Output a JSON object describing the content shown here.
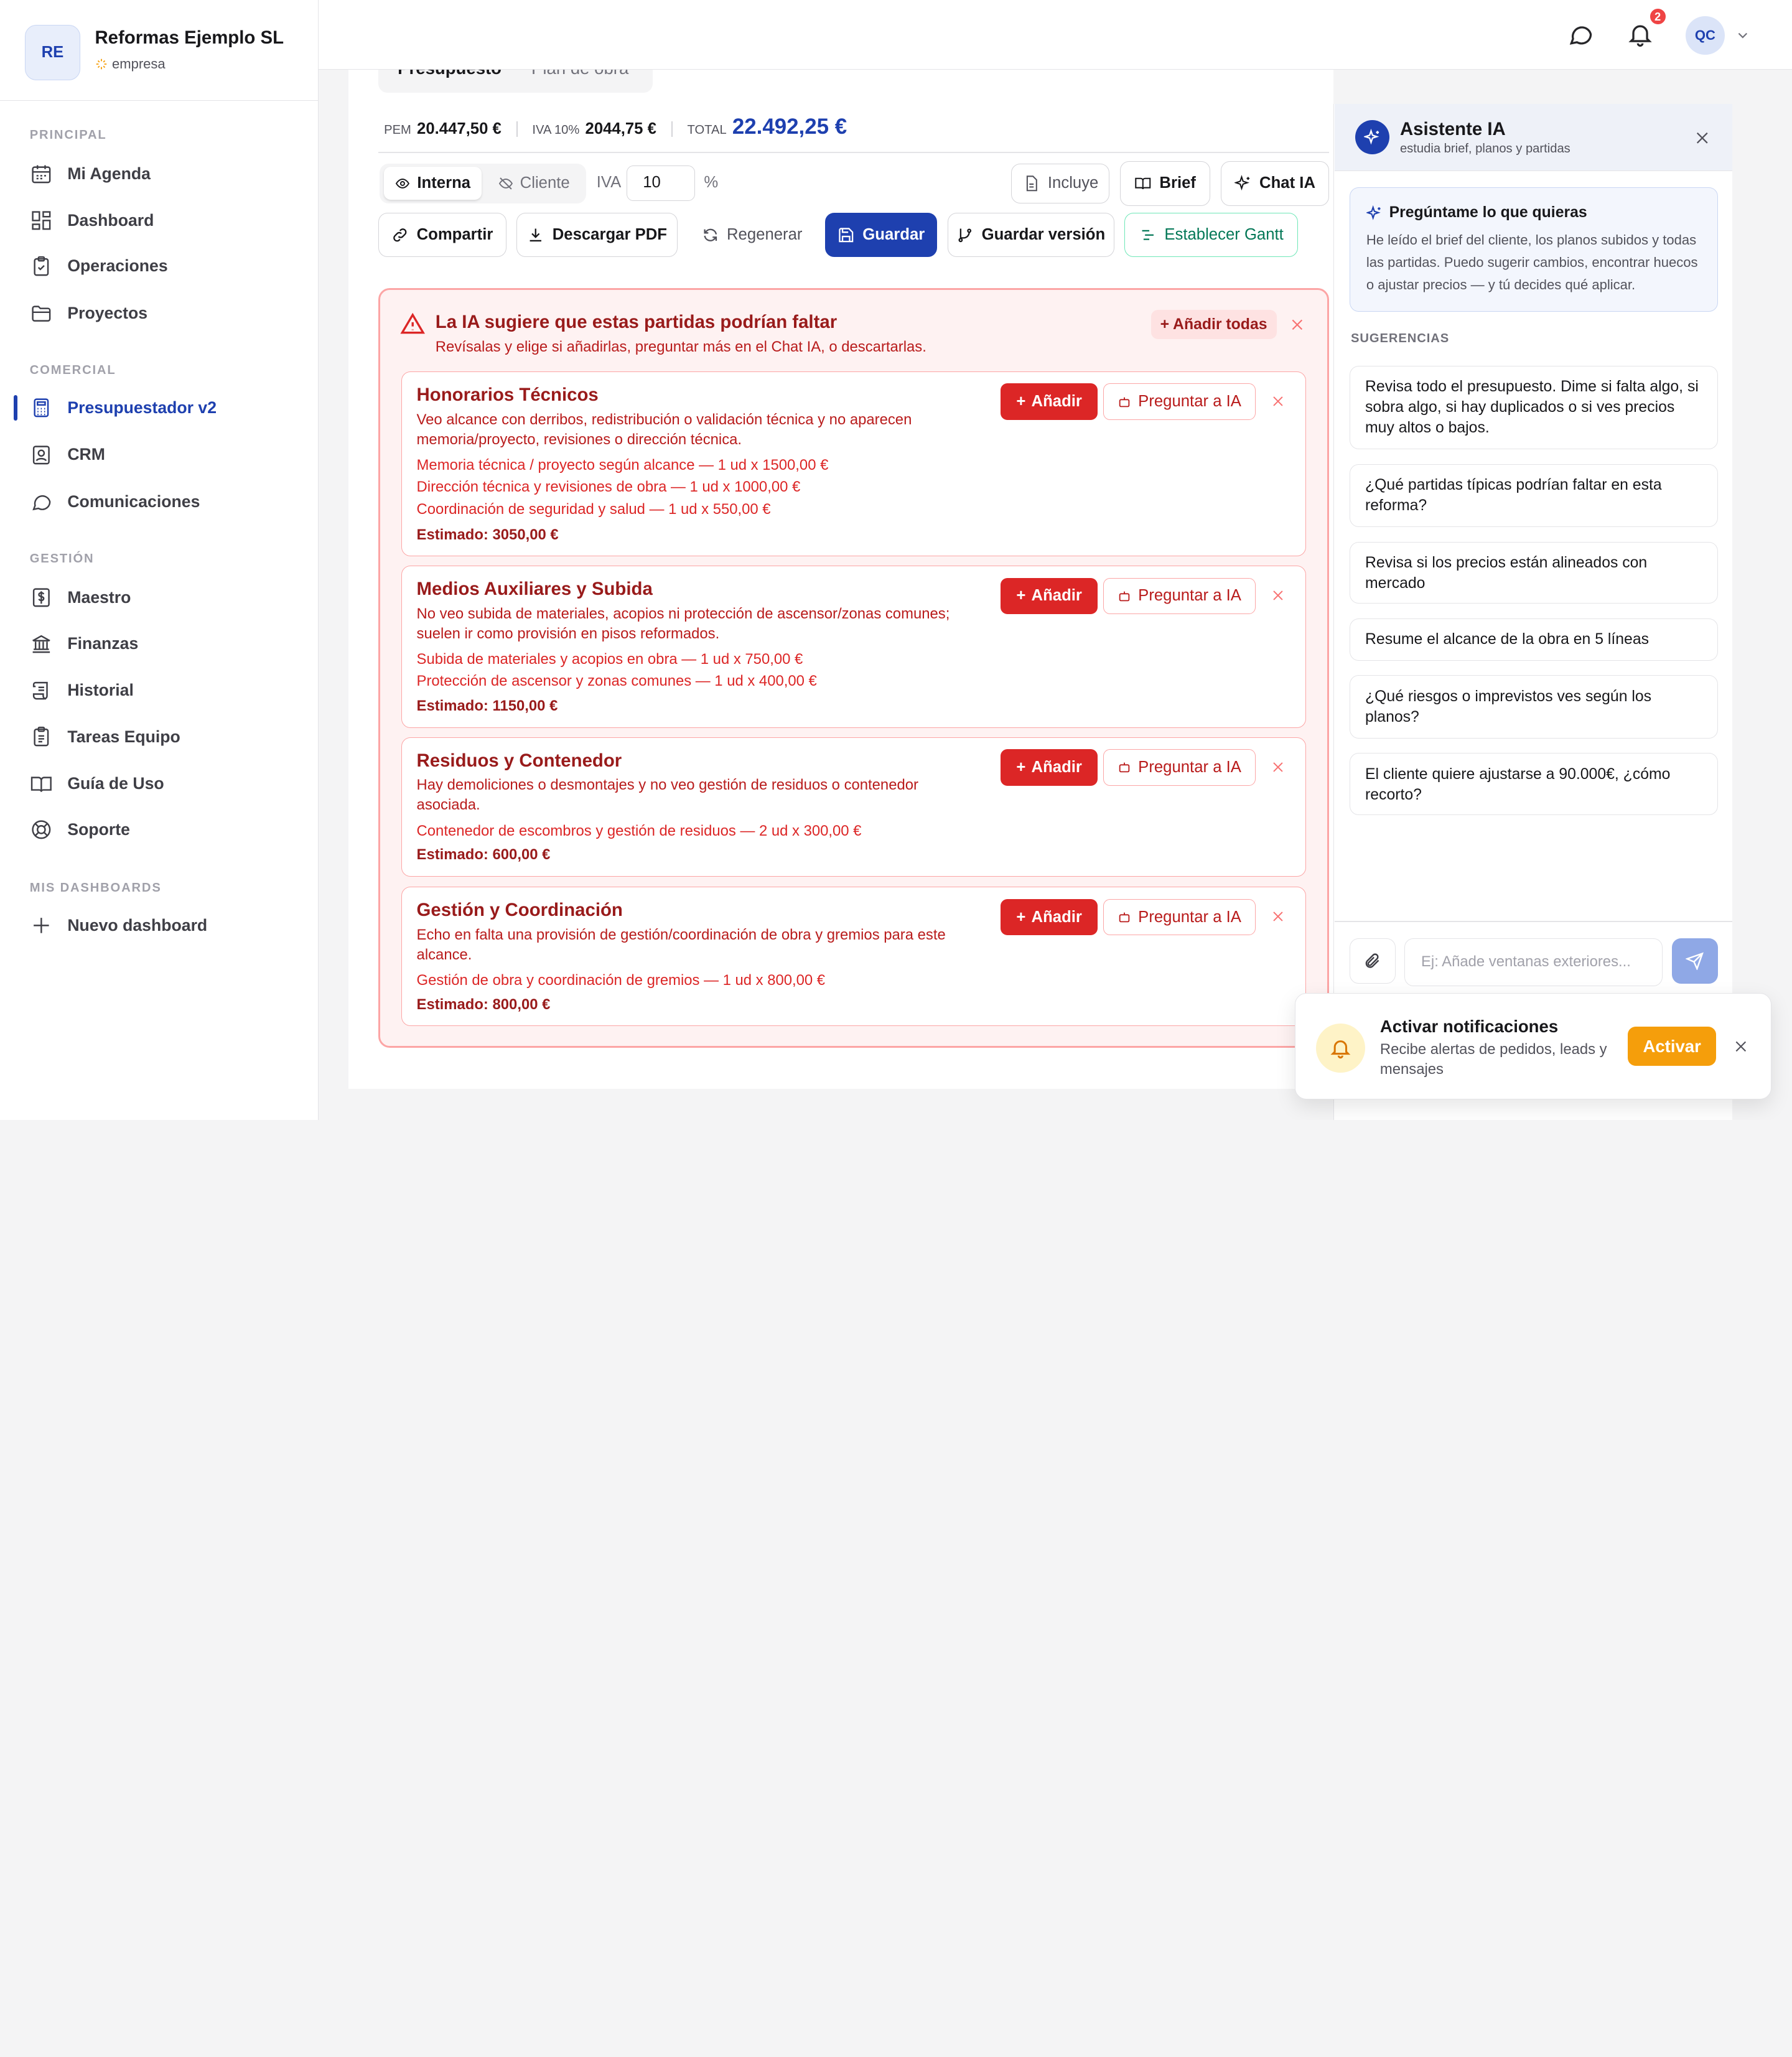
{
  "company": {
    "initials": "RE",
    "name": "Reformas Ejemplo SL",
    "type": "empresa"
  },
  "sidebar": {
    "sections": {
      "principal": "PRINCIPAL",
      "comercial": "COMERCIAL",
      "gestion": "GESTIÓN",
      "dashboards": "MIS DASHBOARDS"
    },
    "items": [
      {
        "label": "Mi Agenda",
        "icon": "calendar-icon"
      },
      {
        "label": "Dashboard",
        "icon": "grid-icon"
      },
      {
        "label": "Operaciones",
        "icon": "clipboard-check-icon"
      },
      {
        "label": "Proyectos",
        "icon": "folder-icon"
      },
      {
        "label": "Presupuestador v2",
        "icon": "calculator-icon",
        "active": true
      },
      {
        "label": "CRM",
        "icon": "contact-icon"
      },
      {
        "label": "Comunicaciones",
        "icon": "message-icon"
      },
      {
        "label": "Maestro",
        "icon": "dollar-file-icon"
      },
      {
        "label": "Finanzas",
        "icon": "bank-icon"
      },
      {
        "label": "Historial",
        "icon": "scroll-icon"
      },
      {
        "label": "Tareas Equipo",
        "icon": "clipboard-list-icon"
      },
      {
        "label": "Guía de Uso",
        "icon": "book-icon"
      },
      {
        "label": "Soporte",
        "icon": "lifebuoy-icon"
      },
      {
        "label": "Nuevo dashboard",
        "icon": "plus-icon"
      }
    ]
  },
  "topbar": {
    "notif_count": "2",
    "user_initials": "QC"
  },
  "tabs": [
    "Presupuesto",
    "Plan de obra"
  ],
  "totals": {
    "pem_label": "PEM",
    "pem": "20.447,50 €",
    "iva_label": "IVA 10%",
    "iva": "2044,75 €",
    "total_label": "TOTAL",
    "total": "22.492,25 €"
  },
  "controls": {
    "view_internal": "Interna",
    "view_client": "Cliente",
    "iva_label": "IVA",
    "iva_value": "10",
    "iva_unit": "%",
    "incluye": "Incluye",
    "brief": "Brief",
    "chat": "Chat IA",
    "compartir": "Compartir",
    "descargar": "Descargar PDF",
    "regenerar": "Regenerar",
    "guardar": "Guardar",
    "guardar_version": "Guardar versión",
    "gantt": "Establecer Gantt"
  },
  "suggestions": {
    "title": "La IA sugiere que estas partidas podrían faltar",
    "description": "Revísalas y elige si añadirlas, preguntar más en el Chat IA, o descartarlas.",
    "add_all": "+ Añadir todas",
    "add_label": "Añadir",
    "ask_label": "Preguntar a IA",
    "items": [
      {
        "title": "Honorarios Técnicos",
        "desc": "Veo alcance con derribos, redistribución o validación técnica y no aparecen memoria/proyecto, revisiones o dirección técnica.",
        "lines": [
          "Memoria técnica / proyecto según alcance — 1 ud x 1500,00 €",
          "Dirección técnica y revisiones de obra — 1 ud x 1000,00 €",
          "Coordinación de seguridad y salud — 1 ud x 550,00 €"
        ],
        "estimate": "Estimado: 3050,00 €"
      },
      {
        "title": "Medios Auxiliares y Subida",
        "desc": "No veo subida de materiales, acopios ni protección de ascensor/zonas comunes; suelen ir como provisión en pisos reformados.",
        "lines": [
          "Subida de materiales y acopios en obra — 1 ud x 750,00 €",
          "Protección de ascensor y zonas comunes — 1 ud x 400,00 €"
        ],
        "estimate": "Estimado: 1150,00 €"
      },
      {
        "title": "Residuos y Contenedor",
        "desc": "Hay demoliciones o desmontajes y no veo gestión de residuos o contenedor asociada.",
        "lines": [
          "Contenedor de escombros y gestión de residuos — 2 ud x 300,00 €"
        ],
        "estimate": "Estimado: 600,00 €"
      },
      {
        "title": "Gestión y Coordinación",
        "desc": "Echo en falta una provisión de gestión/coordinación de obra y gremios para este alcance.",
        "lines": [
          "Gestión de obra y coordinación de gremios — 1 ud x 800,00 €"
        ],
        "estimate": "Estimado: 800,00 €"
      }
    ]
  },
  "assistant": {
    "title": "Asistente IA",
    "subtitle": "estudia brief, planos y partidas",
    "intro_title": "Pregúntame lo que quieras",
    "intro_text": "He leído el brief del cliente, los planos subidos y todas las partidas. Puedo sugerir cambios, encontrar huecos o ajustar precios — y tú decides qué aplicar.",
    "suggestions_header": "SUGERENCIAS",
    "prompts": [
      "Revisa todo el presupuesto. Dime si falta algo, si sobra algo, si hay duplicados o si ves precios muy altos o bajos.",
      "¿Qué partidas típicas podrían faltar en esta reforma?",
      "Revisa si los precios están alineados con mercado",
      "Resume el alcance de la obra en 5 líneas",
      "¿Qué riesgos o imprevistos ves según los planos?",
      "El cliente quiere ajustarse a 90.000€, ¿cómo recorto?"
    ],
    "input_placeholder": "Ej: Añade ventanas exteriores..."
  },
  "toast": {
    "title": "Activar notificaciones",
    "text": "Recibe alertas de pedidos, leads y mensajes",
    "button": "Activar"
  },
  "colors": {
    "primary": "#1e40af",
    "danger": "#dc2626",
    "warning": "#f59e0b",
    "success": "#047857"
  }
}
